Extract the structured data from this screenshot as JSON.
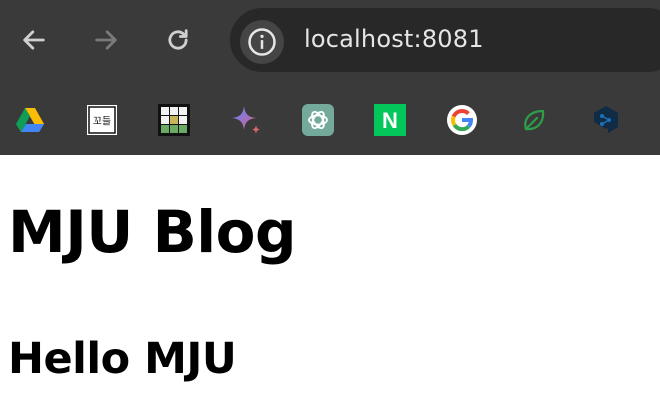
{
  "browser": {
    "address_bar": {
      "url": "localhost:8081"
    },
    "nav": {
      "back_icon": "arrow-left",
      "forward_icon": "arrow-right",
      "reload_icon": "reload",
      "site_info_icon": "info-circle"
    },
    "bookmarks": [
      {
        "icon": "google-drive",
        "label_visible": ""
      },
      {
        "icon": "kkodle",
        "label_visible": "꼬들"
      },
      {
        "icon": "grid-game",
        "label_visible": ""
      },
      {
        "icon": "gemini",
        "label_visible": ""
      },
      {
        "icon": "chatgpt",
        "label_visible": ""
      },
      {
        "icon": "naver",
        "label_visible": "N"
      },
      {
        "icon": "google",
        "label_visible": "G"
      },
      {
        "icon": "leaf",
        "label_visible": ""
      },
      {
        "icon": "deepl",
        "label_visible": ""
      }
    ],
    "colors": {
      "chrome_bg": "#3a3a3a",
      "omnibox_bg": "#282828",
      "url_text": "#e6e6e6"
    }
  },
  "page": {
    "heading": "MJU Blog",
    "subheading": "Hello MJU"
  }
}
